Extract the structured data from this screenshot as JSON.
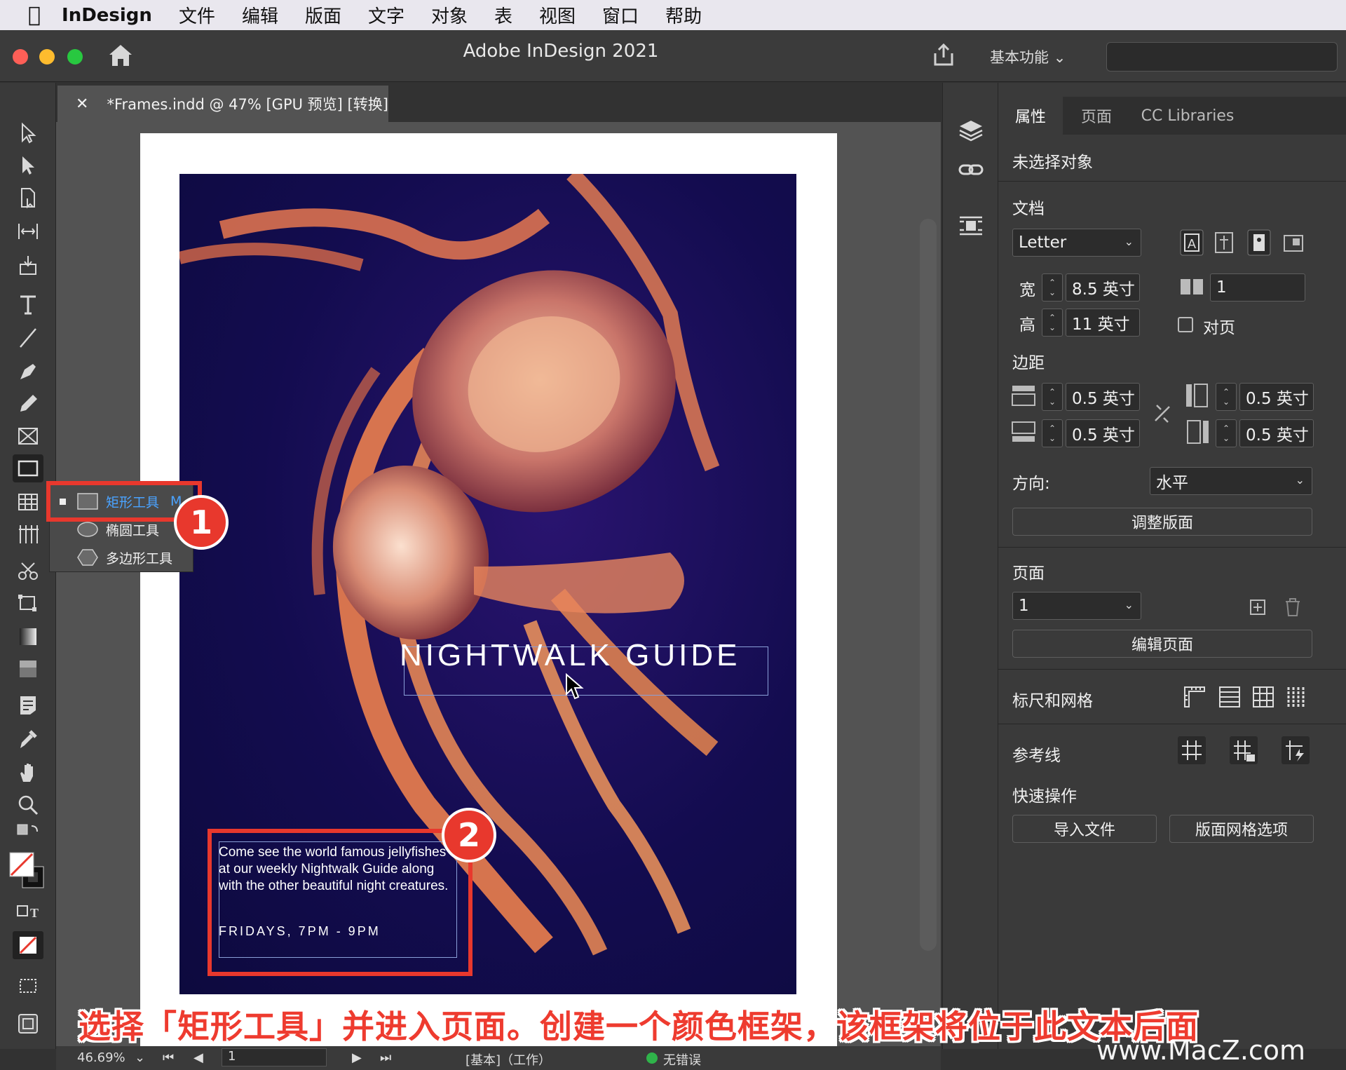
{
  "menubar": {
    "app": "InDesign",
    "items": [
      "文件",
      "编辑",
      "版面",
      "文字",
      "对象",
      "表",
      "视图",
      "窗口",
      "帮助"
    ]
  },
  "window": {
    "title": "Adobe InDesign 2021",
    "workspace": "基本功能"
  },
  "document": {
    "tab_title": "*Frames.indd @ 47% [GPU 预览] [转换]",
    "headline": "NIGHTWALK GUIDE",
    "body_text": "Come see the world famous jellyfishes at our weekly Nightwalk Guide along with the other beautiful night creatures.",
    "dates": "FRIDAYS, 7PM - 9PM"
  },
  "flyout": {
    "items": [
      {
        "label": "矩形工具",
        "shortcut": "M"
      },
      {
        "label": "椭圆工具"
      },
      {
        "label": "多边形工具"
      }
    ]
  },
  "callouts": {
    "one": "1",
    "two": "2"
  },
  "panel": {
    "tabs": [
      "属性",
      "页面",
      "CC Libraries"
    ],
    "no_selection": "未选择对象",
    "document_label": "文档",
    "page_size": "Letter",
    "width_label": "宽",
    "width_value": "8.5 英寸",
    "height_label": "高",
    "height_value": "11 英寸",
    "pages_count": "1",
    "facing_pages": "对页",
    "margins_label": "边距",
    "margin_top": "0.5 英寸",
    "margin_bottom": "0.5 英寸",
    "margin_left": "0.5 英寸",
    "margin_right": "0.5 英寸",
    "orientation_label": "方向:",
    "orientation_value": "水平",
    "adjust_layout": "调整版面",
    "pages_label": "页面",
    "page_select": "1",
    "edit_page": "编辑页面",
    "rulers_grids": "标尺和网格",
    "guides": "参考线",
    "quick_actions": "快速操作",
    "import_file": "导入文件",
    "layout_grid_options": "版面网格选项"
  },
  "statusbar": {
    "zoom": "46.69%",
    "page": "1",
    "profile": "[基本]（工作）",
    "preflight": "无错误"
  },
  "caption": "选择「矩形工具」并进入页面。创建一个颜色框架，该框架将位于此文本后面",
  "watermark": "www.MacZ.com",
  "colors": {
    "accent_red": "#e8382d",
    "highlight_blue": "#4aa3ff",
    "status_green": "#2fb34a",
    "photo_navy": "#130c4f"
  }
}
